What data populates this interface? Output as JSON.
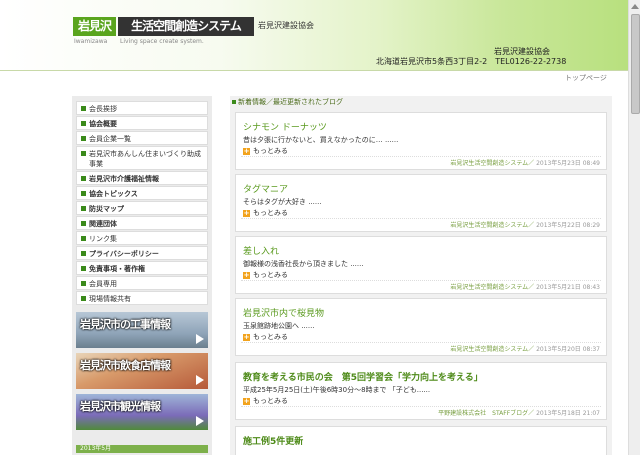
{
  "header": {
    "logo_green": "岩見沢",
    "logo_black": "生活空間創造システム",
    "logo_sub_left": "Iwamizawa",
    "logo_sub_right": "Living space create system.",
    "assoc_top": "岩見沢建設協会",
    "assoc_right": "岩見沢建設協会",
    "address": "北海道岩見沢市5条西3丁目2-2　TEL0126-22-2738"
  },
  "top_link": "トップページ",
  "sidebar": {
    "items": [
      {
        "label": "会長挨拶",
        "bold": false
      },
      {
        "label": "協会概要",
        "bold": true
      },
      {
        "label": "会員企業一覧",
        "bold": false
      },
      {
        "label": "岩見沢市あんしん住まいづくり助成事業",
        "bold": false
      },
      {
        "label": "岩見沢市介護福祉情報",
        "bold": true
      },
      {
        "label": "協会トピックス",
        "bold": true
      },
      {
        "label": "防災マップ",
        "bold": true
      },
      {
        "label": "関連団体",
        "bold": true
      },
      {
        "label": "リンク集",
        "bold": false
      },
      {
        "label": "プライバシーポリシー",
        "bold": true
      },
      {
        "label": "免責事項・著作権",
        "bold": true
      },
      {
        "label": "会員専用",
        "bold": false
      },
      {
        "label": "現場情報共有",
        "bold": false
      }
    ],
    "banners": [
      {
        "label": "岩見沢市の工事情報"
      },
      {
        "label": "岩見沢市飲食店情報"
      },
      {
        "label": "岩見沢市観光情報"
      }
    ],
    "calendar_heading": "2013年5月"
  },
  "main": {
    "heading": "新着情報／最近更新されたブログ",
    "more_label": "もっとみる",
    "posts": [
      {
        "title": "シナモン ドーナッツ",
        "body": "昔は夕張に行かないと、買えなかったのに…  ......",
        "author": "岩見沢生活空間創造システム／",
        "date": "2013年5月23日 08:49"
      },
      {
        "title": "タグマニア",
        "body": "そらはタグが大好き ......",
        "author": "岩見沢生活空間創造システム／",
        "date": "2013年5月22日 08:29"
      },
      {
        "title": "差し入れ",
        "body": "御報様の浅香社長から頂きました  ......",
        "author": "岩見沢生活空間創造システム／",
        "date": "2013年5月21日 08:43"
      },
      {
        "title": "岩見沢市内で桜見物",
        "body": "玉泉館跡地公園へ ......",
        "author": "岩見沢生活空間創造システム／",
        "date": "2013年5月20日 08:37"
      },
      {
        "title": "教育を考える市民の会　第5回学習会「学力向上を考える」",
        "body": "平成25年5月25日(土)午後6時30分～8時まで 「子ども......",
        "author": "平野建設株式会社　STAFFブログ／",
        "date": "2013年5月18日 21:07"
      },
      {
        "title": "施工例5件更新",
        "body": "",
        "author": "",
        "date": ""
      }
    ]
  },
  "colors": {
    "brand_green": "#5aa51e",
    "accent_orange": "#f2a31d",
    "logo_dark": "#333333"
  }
}
